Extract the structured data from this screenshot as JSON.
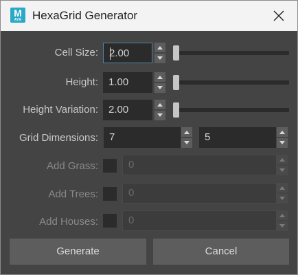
{
  "window": {
    "title": "HexaGrid Generator",
    "app_icon_letter": "M",
    "app_icon_sub": "AYA"
  },
  "form": {
    "cell_size": {
      "label": "Cell Size:",
      "value": "2.00",
      "slider_level": 0
    },
    "height": {
      "label": "Height:",
      "value": "1.00",
      "slider_level": 0
    },
    "height_variation": {
      "label": "Height Variation:",
      "value": "2.00",
      "slider_level": 0
    },
    "grid_dimensions": {
      "label": "Grid Dimensions:",
      "value_x": "7",
      "value_y": "5"
    },
    "add_grass": {
      "label": "Add Grass:",
      "checked": false,
      "value": "0"
    },
    "add_trees": {
      "label": "Add Trees:",
      "checked": false,
      "value": "0"
    },
    "add_houses": {
      "label": "Add Houses:",
      "checked": false,
      "value": "0"
    }
  },
  "buttons": {
    "generate": "Generate",
    "cancel": "Cancel"
  },
  "colors": {
    "background": "#444444",
    "field": "#2b2b2b",
    "button": "#5d5d5d",
    "focus_border": "#5285a6",
    "app_icon": "#2aa9c7"
  }
}
